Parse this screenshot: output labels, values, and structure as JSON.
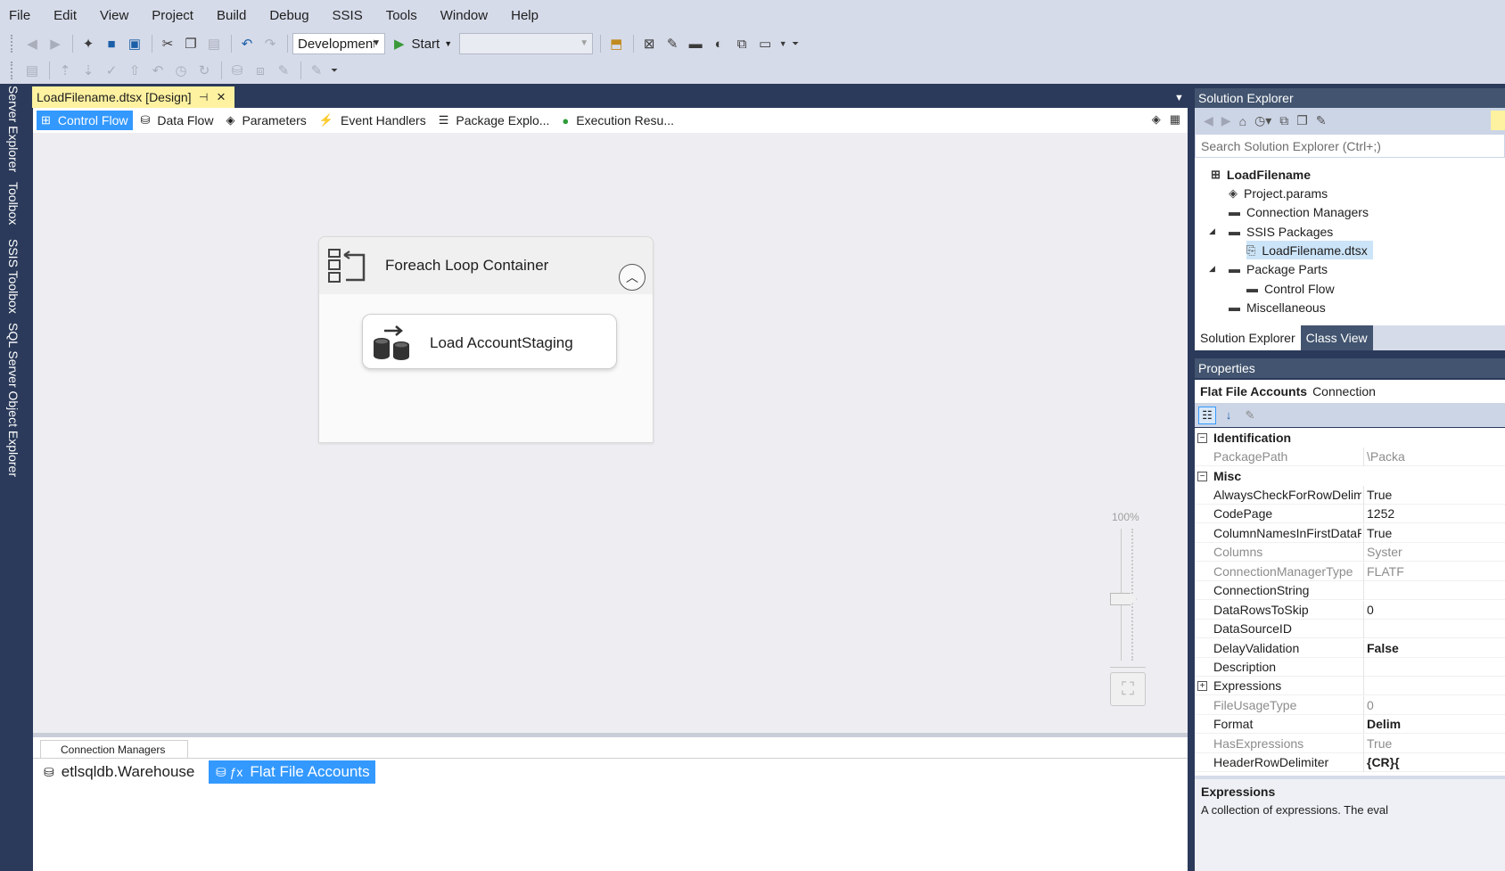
{
  "menu": [
    "File",
    "Edit",
    "View",
    "Project",
    "Build",
    "Debug",
    "SSIS",
    "Tools",
    "Window",
    "Help"
  ],
  "toolbar": {
    "config_value": "Development",
    "start_label": "Start"
  },
  "left_tabs": [
    "Server Explorer",
    "Toolbox",
    "SSIS Toolbox",
    "SQL Server Object Explorer"
  ],
  "document": {
    "tab_title": "LoadFilename.dtsx [Design]"
  },
  "designer_tabs": [
    {
      "label": "Control Flow",
      "icon": "control-flow-icon"
    },
    {
      "label": "Data Flow",
      "icon": "data-flow-icon"
    },
    {
      "label": "Parameters",
      "icon": "parameters-icon"
    },
    {
      "label": "Event Handlers",
      "icon": "event-handlers-icon"
    },
    {
      "label": "Package Explo...",
      "icon": "package-explorer-icon"
    },
    {
      "label": "Execution Resu...",
      "icon": "execution-results-icon"
    }
  ],
  "canvas": {
    "container_title": "Foreach Loop Container",
    "task_label": "Load AccountStaging",
    "zoom_label": "100%"
  },
  "connection_managers": {
    "tab_label": "Connection Managers",
    "items": [
      "etlsqldb.Warehouse",
      "Flat File Accounts"
    ]
  },
  "solution_explorer": {
    "title": "Solution Explorer",
    "search_placeholder": "Search Solution Explorer (Ctrl+;)",
    "tree": [
      {
        "label": "LoadFilename"
      },
      {
        "label": "Project.params"
      },
      {
        "label": "Connection Managers"
      },
      {
        "label": "SSIS Packages"
      },
      {
        "label": "LoadFilename.dtsx"
      },
      {
        "label": "Package Parts"
      },
      {
        "label": "Control Flow"
      },
      {
        "label": "Miscellaneous"
      }
    ],
    "bottom_tabs": [
      "Solution Explorer",
      "Class View"
    ]
  },
  "properties": {
    "title": "Properties",
    "object_name": "Flat File Accounts",
    "object_type": "Connection",
    "categories": {
      "identification": "Identification",
      "misc": "Misc"
    },
    "rows": [
      {
        "name": "PackagePath",
        "value": "\\Packa"
      },
      {
        "name": "AlwaysCheckForRowDelimi",
        "value": "True"
      },
      {
        "name": "CodePage",
        "value": "1252"
      },
      {
        "name": "ColumnNamesInFirstDataRc",
        "value": "True"
      },
      {
        "name": "Columns",
        "value": "Syster"
      },
      {
        "name": "ConnectionManagerType",
        "value": "FLATF"
      },
      {
        "name": "ConnectionString",
        "value": ""
      },
      {
        "name": "DataRowsToSkip",
        "value": "0"
      },
      {
        "name": "DataSourceID",
        "value": ""
      },
      {
        "name": "DelayValidation",
        "value": "False"
      },
      {
        "name": "Description",
        "value": ""
      },
      {
        "name": "Expressions",
        "value": ""
      },
      {
        "name": "FileUsageType",
        "value": "0"
      },
      {
        "name": "Format",
        "value": "Delim"
      },
      {
        "name": "HasExpressions",
        "value": "True"
      },
      {
        "name": "HeaderRowDelimiter",
        "value": "{CR}{"
      }
    ],
    "description_title": "Expressions",
    "description_text": "A collection of expressions. The eval"
  }
}
